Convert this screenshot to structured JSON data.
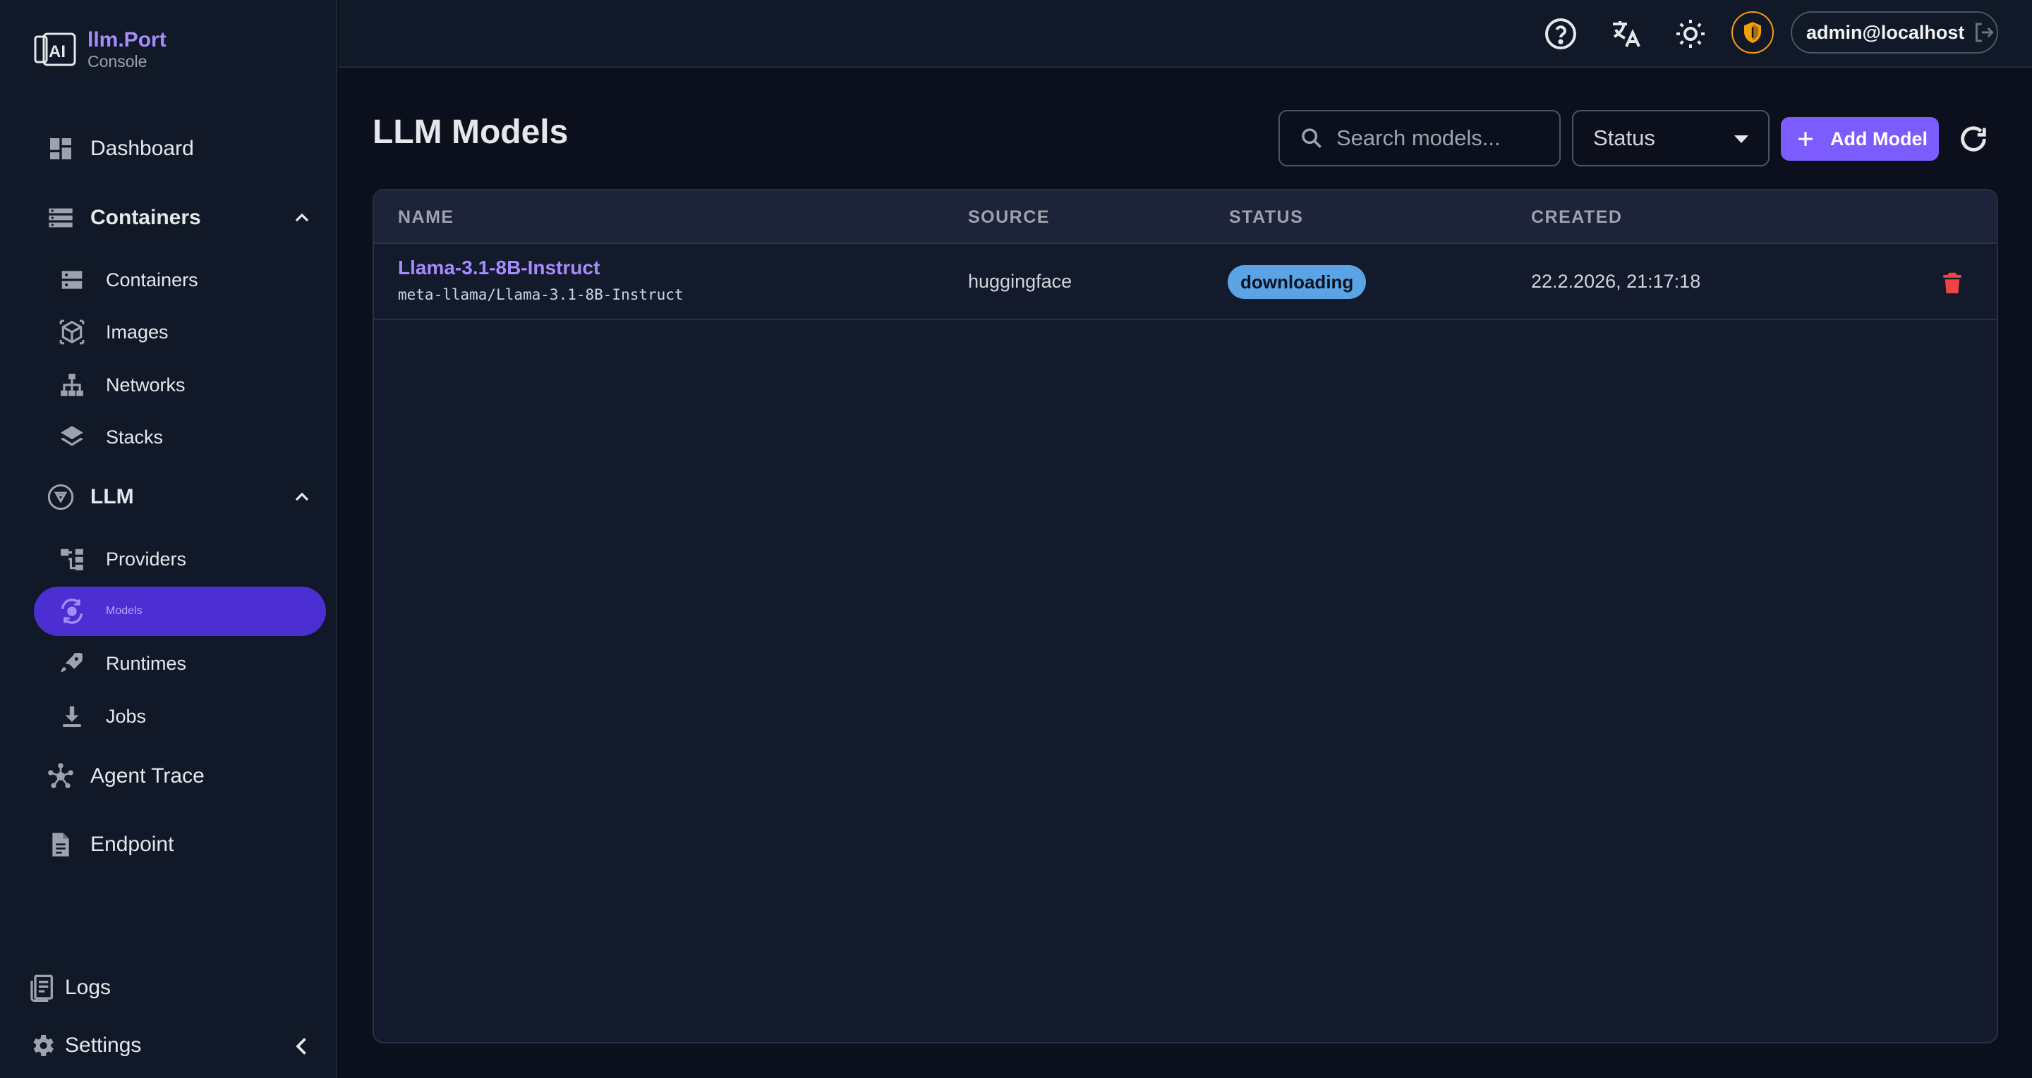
{
  "brand": {
    "name": "llm.Port",
    "subtitle": "Console",
    "logo_icon": "ai-chip-icon"
  },
  "sidebar": {
    "dashboard": {
      "label": "Dashboard",
      "icon": "dashboard-icon"
    },
    "containers_group": {
      "label": "Containers",
      "icon": "server-stack-icon",
      "expanded": true
    },
    "containers_items": [
      {
        "label": "Containers",
        "icon": "server-icon"
      },
      {
        "label": "Images",
        "icon": "cube-icon"
      },
      {
        "label": "Networks",
        "icon": "network-icon"
      },
      {
        "label": "Stacks",
        "icon": "layers-icon"
      }
    ],
    "llm_group": {
      "label": "LLM",
      "icon": "llm-icon",
      "expanded": true
    },
    "llm_items": [
      {
        "label": "Providers",
        "icon": "providers-icon"
      },
      {
        "label": "Models",
        "icon": "models-icon",
        "active": true
      },
      {
        "label": "Runtimes",
        "icon": "rocket-icon"
      },
      {
        "label": "Jobs",
        "icon": "download-icon"
      }
    ],
    "agent_trace": {
      "label": "Agent Trace",
      "icon": "graph-icon"
    },
    "endpoint": {
      "label": "Endpoint",
      "icon": "document-icon"
    },
    "logs": {
      "label": "Logs",
      "icon": "logs-icon"
    },
    "settings": {
      "label": "Settings",
      "icon": "gear-icon"
    }
  },
  "topbar": {
    "user": "admin@localhost"
  },
  "main": {
    "title": "LLM Models",
    "search_placeholder": "Search models...",
    "status_filter": "Status",
    "add_label": "Add Model",
    "columns": [
      "NAME",
      "SOURCE",
      "STATUS",
      "CREATED"
    ],
    "rows": [
      {
        "name": "Llama-3.1-8B-Instruct",
        "repo": "meta-llama/Llama-3.1-8B-Instruct",
        "source": "huggingface",
        "status": "downloading",
        "created": "22.2.2026, 21:17:18"
      }
    ]
  },
  "colors": {
    "accent": "#7c5cff",
    "active_nav": "#4c2fd2",
    "status_downloading": "#5aa4e6",
    "danger": "#ef4444",
    "shield": "#f59e0b"
  }
}
